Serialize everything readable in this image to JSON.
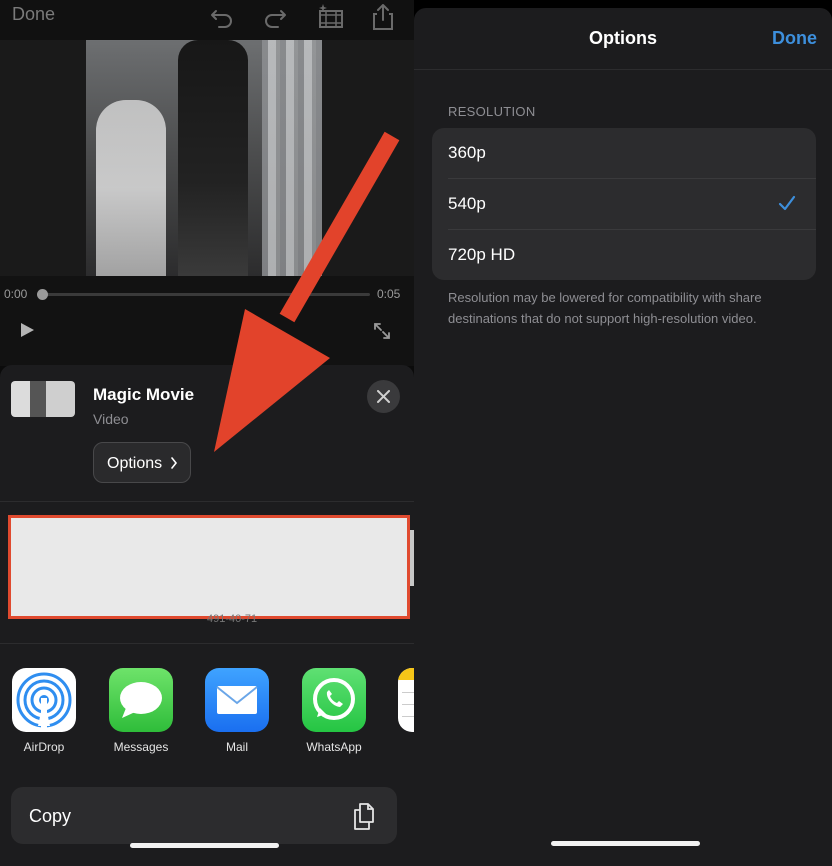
{
  "left": {
    "toolbar": {
      "done_label": "Done"
    },
    "player": {
      "time_start": "0:00",
      "time_end": "0:05",
      "progress": 0
    },
    "share_sheet": {
      "title": "Magic Movie",
      "subtitle": "Video",
      "options_label": "Options",
      "peek_text": "491-40-71",
      "apps": [
        {
          "label": "AirDrop",
          "icon": "airdrop-icon"
        },
        {
          "label": "Messages",
          "icon": "messages-icon"
        },
        {
          "label": "Mail",
          "icon": "mail-icon"
        },
        {
          "label": "WhatsApp",
          "icon": "whatsapp-icon"
        }
      ],
      "copy_label": "Copy"
    }
  },
  "right": {
    "title": "Options",
    "done_label": "Done",
    "section_header": "RESOLUTION",
    "resolutions": [
      {
        "label": "360p",
        "selected": false
      },
      {
        "label": "540p",
        "selected": true
      },
      {
        "label": "720p HD",
        "selected": false
      }
    ],
    "footnote": "Resolution may be lowered for compatibility with share destinations that do not support high-resolution video."
  },
  "colors": {
    "accent": "#3d8fdc",
    "annotation": "#e04a2f",
    "sheet_bg": "#1c1c1e",
    "cell_bg": "#2c2c2e"
  }
}
